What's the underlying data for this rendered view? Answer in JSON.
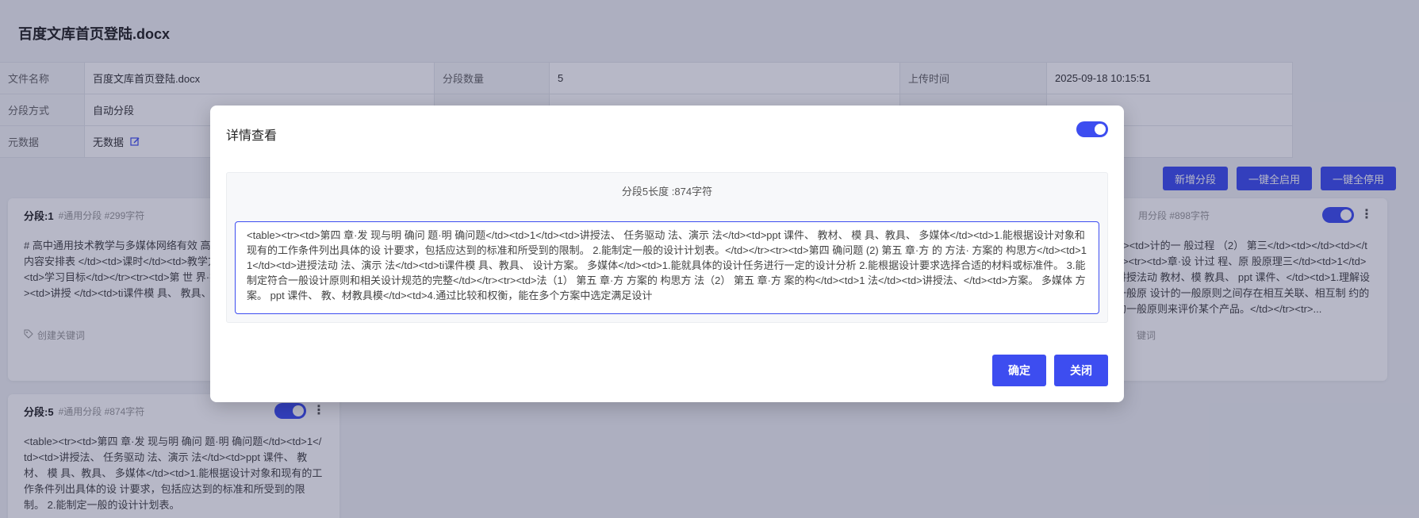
{
  "page": {
    "title": "百度文库首页登陆.docx"
  },
  "meta": {
    "row1": {
      "file_name_label": "文件名称",
      "file_name": "百度文库首页登陆.docx",
      "segment_count_label": "分段数量",
      "segment_count": "5",
      "upload_time_label": "上传时间",
      "upload_time": "2025-09-18 10:15:51"
    },
    "row2": {
      "segment_mode_label": "分段方式",
      "segment_mode": "自动分段"
    },
    "row3": {
      "metadata_label": "元数据",
      "metadata": "无数据"
    }
  },
  "actions": {
    "add_segment": "新增分段",
    "enable_all": "一键全启用",
    "disable_all": "一键全停用"
  },
  "cards": [
    {
      "title": "分段:1",
      "sub": "#通用分段 #299字符",
      "body": "# 高中通用技术教学与多媒体网络有效 高中《技术与设计 1》教学内容安排表 </td><td>课时</td><td>教学方法</td><td>教 具</td><td>学习目标</td></tr><tr><td>第 世 界·技 术的价</td><td>1</td><td>讲授 </td><td>ti课件模 具、 教具、 多媒体",
      "keyword": "创建关键词"
    },
    {
      "title": "用分段 #898字符",
      "body": "章</td><td>计的一 般过程 （2） 第三</td><td></td><td></td></tr><tr><td>章·设 计过 程、原 股原理三</td><td>1</td><td>讲授法动 教材、模 教具、 ppt 课件、</td><td>1.理解设计的一般原 设计的一般原则之间存在相互关联、相互制 约的 设计的一般原则来评价某个产品。</td></tr><tr>...",
      "keyword": "键词"
    },
    {
      "title": "分段:5",
      "sub": "#通用分段 #874字符",
      "body": "<table><tr><td>第四 章·发 现与明 确问 题·明 确问题</td><td>1</td><td>讲授法、 任务驱动 法、演示 法</td><td>ppt 课件、 教材、 模 具、教具、 多媒体</td><td>1.能根据设计对象和现有的工作条件列出具体的设 计要求，包括应达到的标准和所受到的限制。 2.能制定一般的设计计划表。"
    }
  ],
  "modal": {
    "title": "详情查看",
    "panel_head": "分段5长度 :874字符",
    "text": "<table><tr><td>第四 章·发 现与明 确问 题·明 确问题</td><td>1</td><td>讲授法、 任务驱动 法、演示 法</td><td>ppt 课件、 教材、 模 具、教具、 多媒体</td><td>1.能根据设计对象和现有的工作条件列出具体的设 计要求，包括应达到的标准和所受到的限制。 2.能制定一般的设计计划表。</td></tr><tr><td>第四 确问题 (2)  第五 章·方 的 方法· 方案的 构思方</td><td>1 1</td><td>进授法动 法、演示 法</td><td>ti课件模 具、教具、 设计方案。 多媒体</td><td>1.能就具体的设计任务进行一定的设计分析 2.能根据设计要求选择合适的材料或标准件。 3.能制定符合一般设计原则和相关设计规范的完整</td></tr><tr><td>法（1） 第五 章·方 方案的 构思方 法（2） 第五 章·方 案的构</td><td>1 法</td><td>讲授法、</td><td>方案。 多媒体 方案。 ppt 课件、 教、材教具模</td><td>4.通过比较和权衡，能在多个方案中选定满足设计",
    "confirm": "确定",
    "close": "关闭"
  },
  "colors": {
    "accent": "#3d4df0"
  },
  "icons": {
    "edit": "edit-icon",
    "tag": "tag-icon",
    "more": "more-vertical-icon"
  }
}
